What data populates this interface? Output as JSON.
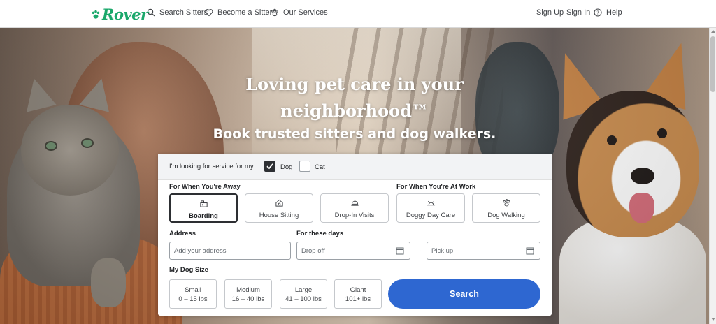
{
  "header": {
    "logo": "Rover",
    "nav_left": [
      "Search Sitters",
      "Become a Sitter",
      "Our Services"
    ],
    "nav_right": [
      "Sign Up",
      "Sign In",
      "Help"
    ]
  },
  "hero": {
    "title_line1": "Loving pet care in your",
    "title_line2": "neighborhood™",
    "subtitle": "Book trusted sitters and dog walkers."
  },
  "search": {
    "looking_label": "I'm looking for service for my:",
    "pets": [
      {
        "label": "Dog",
        "checked": true
      },
      {
        "label": "Cat",
        "checked": false
      }
    ],
    "away_heading": "For When You're Away",
    "work_heading": "For When You're At Work",
    "services": [
      {
        "label": "Boarding",
        "icon": "boarding-icon",
        "selected": true
      },
      {
        "label": "House Sitting",
        "icon": "house-sitting-icon",
        "selected": false
      },
      {
        "label": "Drop-In Visits",
        "icon": "drop-in-icon",
        "selected": false
      },
      {
        "label": "Doggy Day Care",
        "icon": "sun-icon",
        "selected": false
      },
      {
        "label": "Dog Walking",
        "icon": "paw-icon",
        "selected": false
      }
    ],
    "address_label": "Address",
    "address_placeholder": "Add your address",
    "dates_label": "For these days",
    "dropoff_placeholder": "Drop off",
    "arrow": "→",
    "pickup_placeholder": "Pick up",
    "size_label": "My Dog Size",
    "sizes": [
      {
        "name": "Small",
        "range": "0 – 15 lbs"
      },
      {
        "name": "Medium",
        "range": "16 – 40 lbs"
      },
      {
        "name": "Large",
        "range": "41 – 100 lbs"
      },
      {
        "name": "Giant",
        "range": "101+ lbs"
      }
    ],
    "search_button": "Search"
  },
  "colors": {
    "brand": "#1aa86b",
    "primary": "#2e67d1"
  }
}
